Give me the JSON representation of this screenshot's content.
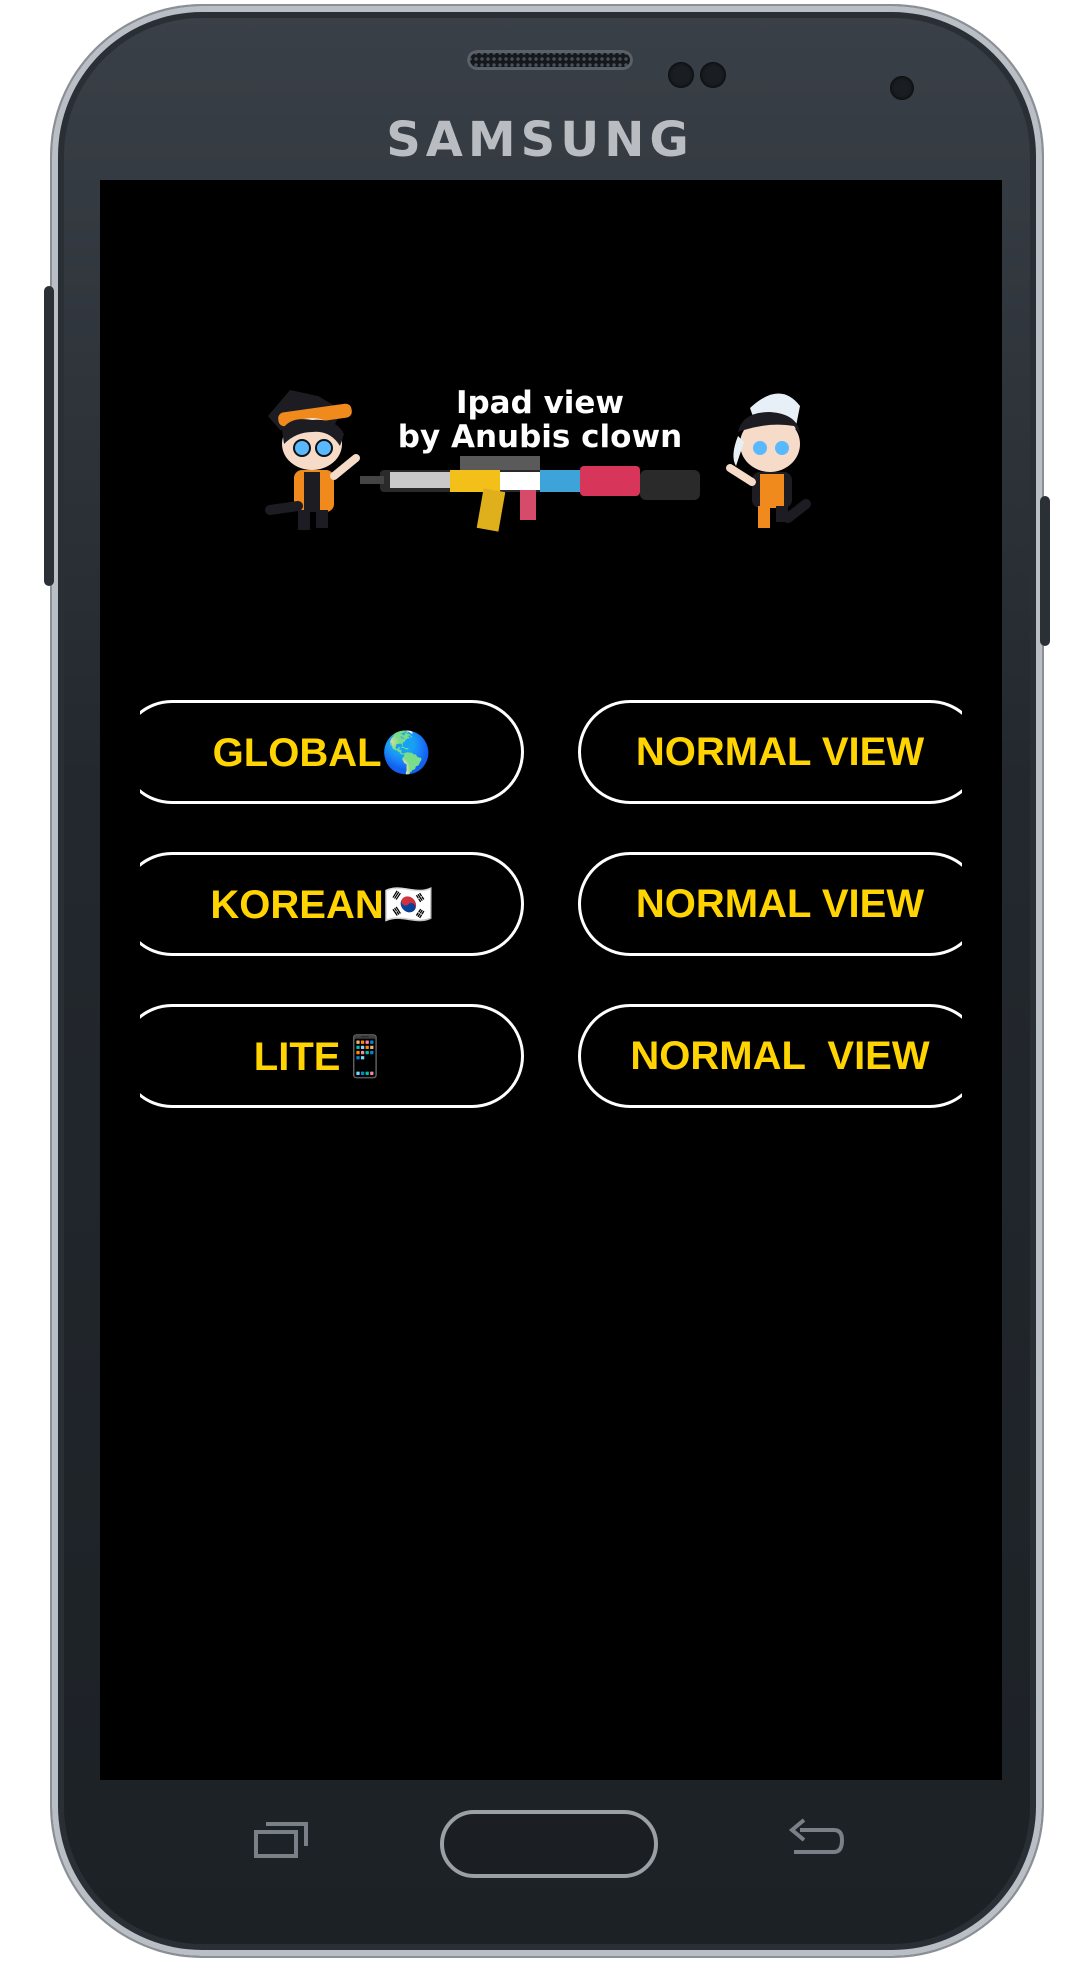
{
  "device": {
    "brand": "SAMSUNG"
  },
  "header": {
    "line1": "Ipad view",
    "line2": "by Anubis clown"
  },
  "buttons": [
    {
      "left_label": "GLOBAL🌎",
      "right_label": "NORMAL VIEW"
    },
    {
      "left_label": "KOREAN🇰🇷",
      "right_label": "NORMAL VIEW"
    },
    {
      "left_label": "LITE📱",
      "right_label": "NORMAL  VIEW"
    }
  ],
  "colors": {
    "button_text": "#ffd400",
    "button_border": "#ffffff",
    "screen_bg": "#000000"
  },
  "nav_icons": [
    "recent-apps-icon",
    "home-button",
    "back-icon"
  ]
}
